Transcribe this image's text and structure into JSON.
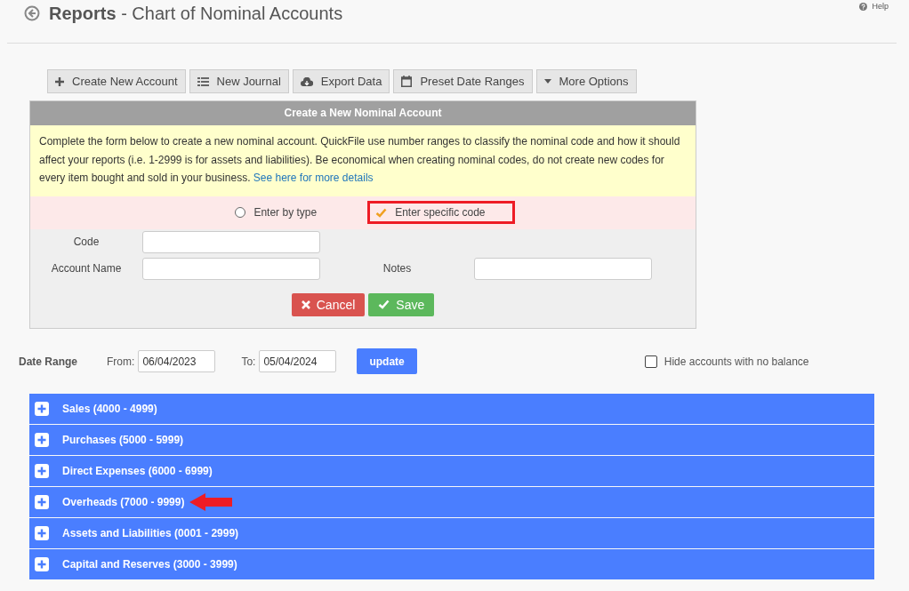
{
  "header": {
    "title": "Reports",
    "subtitle": "- Chart of Nominal Accounts",
    "help": "Help"
  },
  "toolbar": [
    {
      "label": "Create New Account",
      "kind": "create"
    },
    {
      "label": "New Journal",
      "kind": "journal"
    },
    {
      "label": "Export Data",
      "kind": "export"
    },
    {
      "label": "Preset Date Ranges",
      "kind": "dates"
    },
    {
      "label": "More Options",
      "kind": "more"
    }
  ],
  "panel": {
    "title": "Create a New Nominal Account",
    "info": "Complete the form below to create a new nominal account. QuickFile use number ranges to classify the nominal code and how it should affect your reports (i.e. 1-2999 is for assets and liabilities). Be economical when creating nominal codes, do not create new codes for every item bought and sold in your business.",
    "info_link": "See here for more details",
    "options": [
      {
        "label": "Enter by type",
        "selected": false,
        "highlighted": false
      },
      {
        "label": "Enter specific code",
        "selected": true,
        "highlighted": true
      }
    ],
    "code_label": "Code",
    "name_label": "Account Name",
    "notes_label": "Notes",
    "cancel": "Cancel",
    "save": "Save"
  },
  "date_range": {
    "label": "Date Range",
    "from_label": "From:",
    "from": "06/04/2023",
    "to_label": "To:",
    "to": "05/04/2024",
    "update": "update",
    "hide_label": "Hide accounts with no balance",
    "hide_checked": false
  },
  "groups": [
    {
      "label": "Sales (4000 - 4999)",
      "arrow": false
    },
    {
      "label": "Purchases (5000 - 5999)",
      "arrow": false
    },
    {
      "label": "Direct Expenses (6000 - 6999)",
      "arrow": false
    },
    {
      "label": "Overheads (7000 - 9999)",
      "arrow": true
    },
    {
      "label": "Assets and Liabilities (0001 - 2999)",
      "arrow": false
    },
    {
      "label": "Capital and Reserves (3000 - 3999)",
      "arrow": false
    }
  ]
}
